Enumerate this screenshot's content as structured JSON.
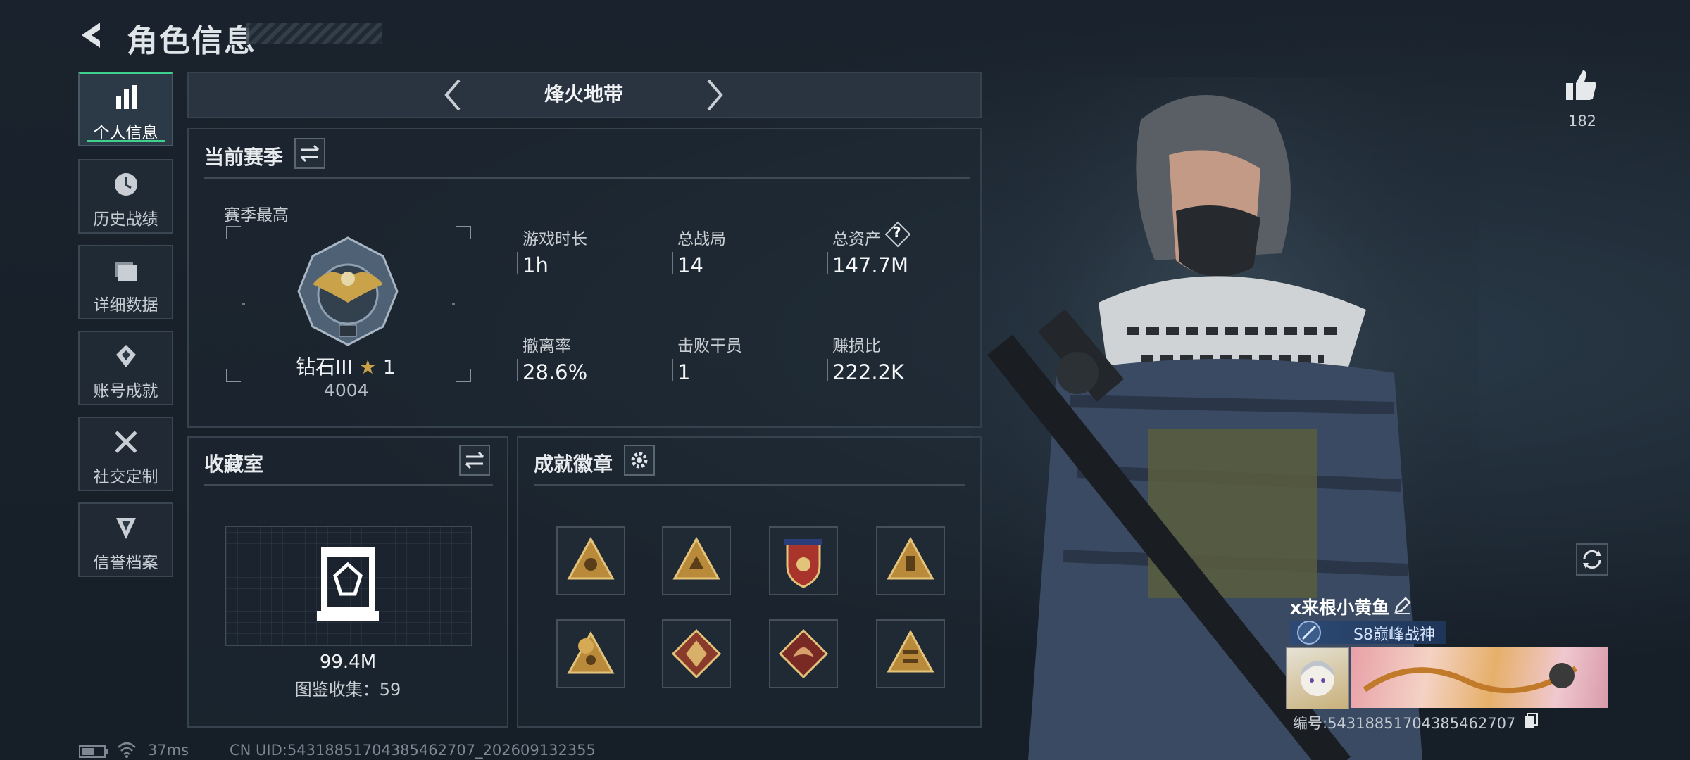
{
  "header": {
    "title": "角色信息"
  },
  "sidebar": {
    "items": [
      {
        "label": "个人信息",
        "icon": "bar-chart-icon",
        "active": true
      },
      {
        "label": "历史战绩",
        "icon": "clock-icon",
        "active": false
      },
      {
        "label": "详细数据",
        "icon": "folder-icon",
        "active": false
      },
      {
        "label": "账号成就",
        "icon": "achievement-icon",
        "active": false
      },
      {
        "label": "社交定制",
        "icon": "tools-icon",
        "active": false
      },
      {
        "label": "信誉档案",
        "icon": "credibility-icon",
        "active": false
      }
    ]
  },
  "mode": {
    "name": "烽火地带"
  },
  "season": {
    "title": "当前赛季",
    "best_label": "赛季最高",
    "rank_name": "钻石III",
    "rank_stars": "1",
    "rank_score": "4004",
    "stats": [
      {
        "label": "游戏时长",
        "value": "1h"
      },
      {
        "label": "总战局",
        "value": "14"
      },
      {
        "label": "总资产",
        "value": "147.7M"
      },
      {
        "label": "撤离率",
        "value": "28.6%"
      },
      {
        "label": "击败干员",
        "value": "1"
      },
      {
        "label": "赚损比",
        "value": "222.2K"
      }
    ]
  },
  "collection": {
    "title": "收藏室",
    "value": "99.4M",
    "count_label": "图鉴收集：59"
  },
  "badges": {
    "title": "成就徽章"
  },
  "profile": {
    "likes": "182",
    "player_name": "x来根小黄鱼",
    "title_badge": "S8巅峰战神",
    "id_line": "编号:543188517043854627​07"
  },
  "status_bar": {
    "ping": "37ms",
    "uid": "CN UID:5431885170438546​2707_202609132355"
  },
  "colors": {
    "accent_green": "#3fd08e",
    "panel_border": "#36424e",
    "gold": "#c9a24a"
  }
}
